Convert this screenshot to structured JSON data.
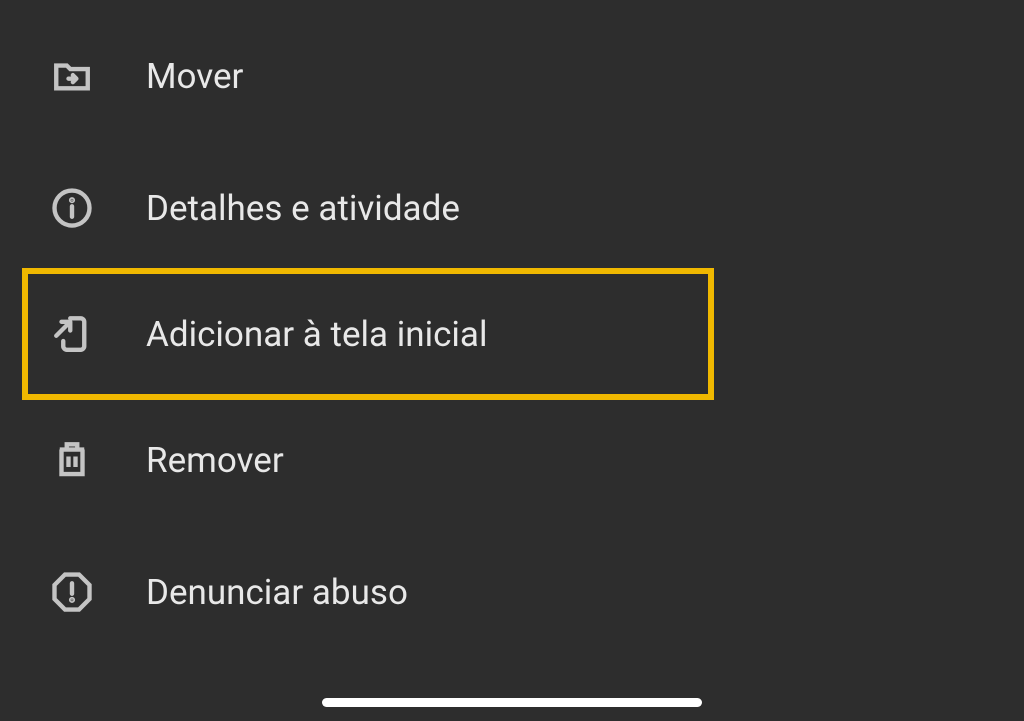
{
  "menu": {
    "items": [
      {
        "label": "Mover",
        "icon": "move-folder-icon",
        "highlighted": false
      },
      {
        "label": "Detalhes e atividade",
        "icon": "info-icon",
        "highlighted": false
      },
      {
        "label": "Adicionar à tela inicial",
        "icon": "add-to-home-icon",
        "highlighted": true
      },
      {
        "label": "Remover",
        "icon": "trash-icon",
        "highlighted": false
      },
      {
        "label": "Denunciar abuso",
        "icon": "warning-icon",
        "highlighted": false
      }
    ]
  },
  "colors": {
    "background": "#2d2d2d",
    "text": "#e8e8e8",
    "icon": "#c4c4c4",
    "highlight": "#f0b800"
  }
}
